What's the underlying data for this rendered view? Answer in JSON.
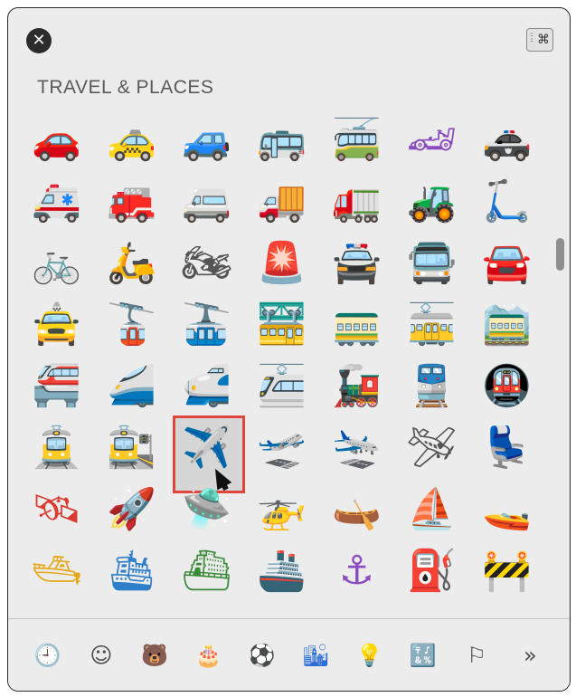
{
  "window": {
    "close_glyph": "✕",
    "viewer_glyph": "⌘"
  },
  "section": {
    "title": "TRAVEL & PLACES"
  },
  "emoji_rows": [
    [
      "🚗",
      "🚕",
      "🚙",
      "🚌",
      "🚎",
      "🏎",
      "🚓"
    ],
    [
      "🚑",
      "🚒",
      "🚐",
      "🚚",
      "🚛",
      "🚜",
      "🛴"
    ],
    [
      "🚲",
      "🛵",
      "🏍",
      "🚨",
      "🚔",
      "🚍",
      "🚘"
    ],
    [
      "🚖",
      "🚡",
      "🚠",
      "🚟",
      "🚃",
      "🚋",
      "🚞"
    ],
    [
      "🚝",
      "🚄",
      "🚅",
      "🚈",
      "🚂",
      "🚆",
      "🚇"
    ],
    [
      "🚊",
      "🚉",
      "✈️",
      "🛫",
      "🛬",
      "🛩",
      "💺"
    ],
    [
      "🛰",
      "🚀",
      "🛸",
      "🚁",
      "🛶",
      "⛵",
      "🚤"
    ],
    [
      "🛥",
      "🛳",
      "⛴",
      "🚢",
      "⚓",
      "⛽",
      "🚧"
    ]
  ],
  "selected": {
    "row": 5,
    "col": 2
  },
  "categories": [
    {
      "name": "recent",
      "glyph": "🕘",
      "active": false
    },
    {
      "name": "smileys",
      "glyph": "☺",
      "active": false
    },
    {
      "name": "animals",
      "glyph": "🐻",
      "active": false
    },
    {
      "name": "food",
      "glyph": "🎂",
      "active": false
    },
    {
      "name": "activity",
      "glyph": "⚽",
      "active": false
    },
    {
      "name": "travel",
      "glyph": "🏙",
      "active": true
    },
    {
      "name": "objects",
      "glyph": "💡",
      "active": false
    },
    {
      "name": "symbols",
      "glyph": "🔣",
      "active": false
    },
    {
      "name": "flags",
      "glyph": "⚐",
      "active": false
    }
  ],
  "more_glyph": "»"
}
